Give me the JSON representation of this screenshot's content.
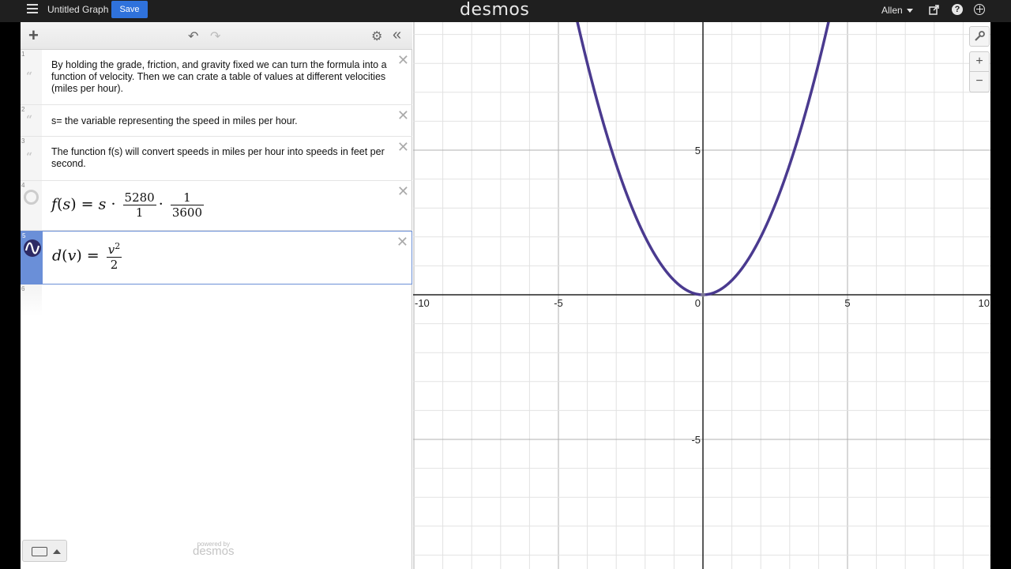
{
  "topbar": {
    "graph_title": "Untitled Graph",
    "save_label": "Save",
    "logo": "desmos",
    "user_name": "Allen",
    "help_glyph": "?"
  },
  "toolbar": {
    "add_glyph": "+",
    "undo_glyph": "↶",
    "redo_glyph": "↷",
    "settings_glyph": "⚙",
    "collapse_glyph": "«"
  },
  "expressions": [
    {
      "num": "1",
      "type": "note",
      "text": "By holding the grade, friction, and gravity fixed we can turn the formula into a function of velocity. Then we can crate a table of values at different velocities (miles per hour)."
    },
    {
      "num": "2",
      "type": "note",
      "text": "s= the variable representing the speed in miles per hour."
    },
    {
      "num": "3",
      "type": "note",
      "text": "The function f(s) will convert speeds in miles per hour into speeds in feet per second."
    },
    {
      "num": "4",
      "type": "math",
      "lhs": "f",
      "arg": "s",
      "rhs_var": "s",
      "frac1_top": "5280",
      "frac1_bot": "1",
      "frac2_top": "1",
      "frac2_bot": "3600"
    },
    {
      "num": "5",
      "type": "math",
      "lhs": "d",
      "arg": "v",
      "rhs_top": "v",
      "rhs_exp": "2",
      "rhs_bot": "2",
      "color": "#4a3a8f"
    },
    {
      "num": "6",
      "type": "empty"
    }
  ],
  "footer": {
    "powered_by": "powered by",
    "powered_logo": "desmos"
  },
  "graph": {
    "x_ticks": [
      "-10",
      "-5",
      "0",
      "5",
      "10"
    ],
    "y_ticks": [
      "5",
      "-5"
    ],
    "x_range": [
      -10,
      10
    ],
    "y_range": [
      -9,
      9.3
    ],
    "curve": "y = x^2/2",
    "curve_color": "#4a3a8f"
  },
  "graph_controls": {
    "wrench_glyph": "🔧",
    "zoom_in": "+",
    "zoom_out": "−"
  },
  "icons": {
    "menu": "hamburger-icon",
    "share": "share-icon",
    "help": "help-icon",
    "globe": "globe-icon",
    "keyboard": "keyboard-icon",
    "note": "quote-icon"
  }
}
